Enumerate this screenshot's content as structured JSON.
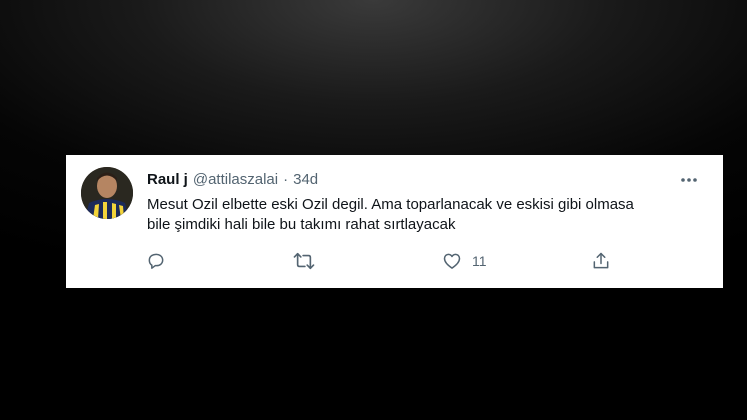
{
  "tweet": {
    "display_name": "Raul j",
    "handle": "@attilaszalai",
    "separator": "·",
    "age": "34d",
    "text_lines": [
      "Mesut Ozil elbette eski Ozil degil. Ama toparlanacak ve eskisi gibi olmasa",
      "bile şimdiki hali bile bu takımı rahat sırtlayacak"
    ],
    "like_count": "11"
  },
  "icons": {
    "more": "more-horizontal-icon",
    "reply": "speech-bubble-icon",
    "retweet": "retweet-arrows-icon",
    "like": "heart-icon",
    "share": "share-upload-icon"
  },
  "colors": {
    "card_background": "#ffffff",
    "text_primary": "#0f1419",
    "text_secondary": "#536471"
  }
}
